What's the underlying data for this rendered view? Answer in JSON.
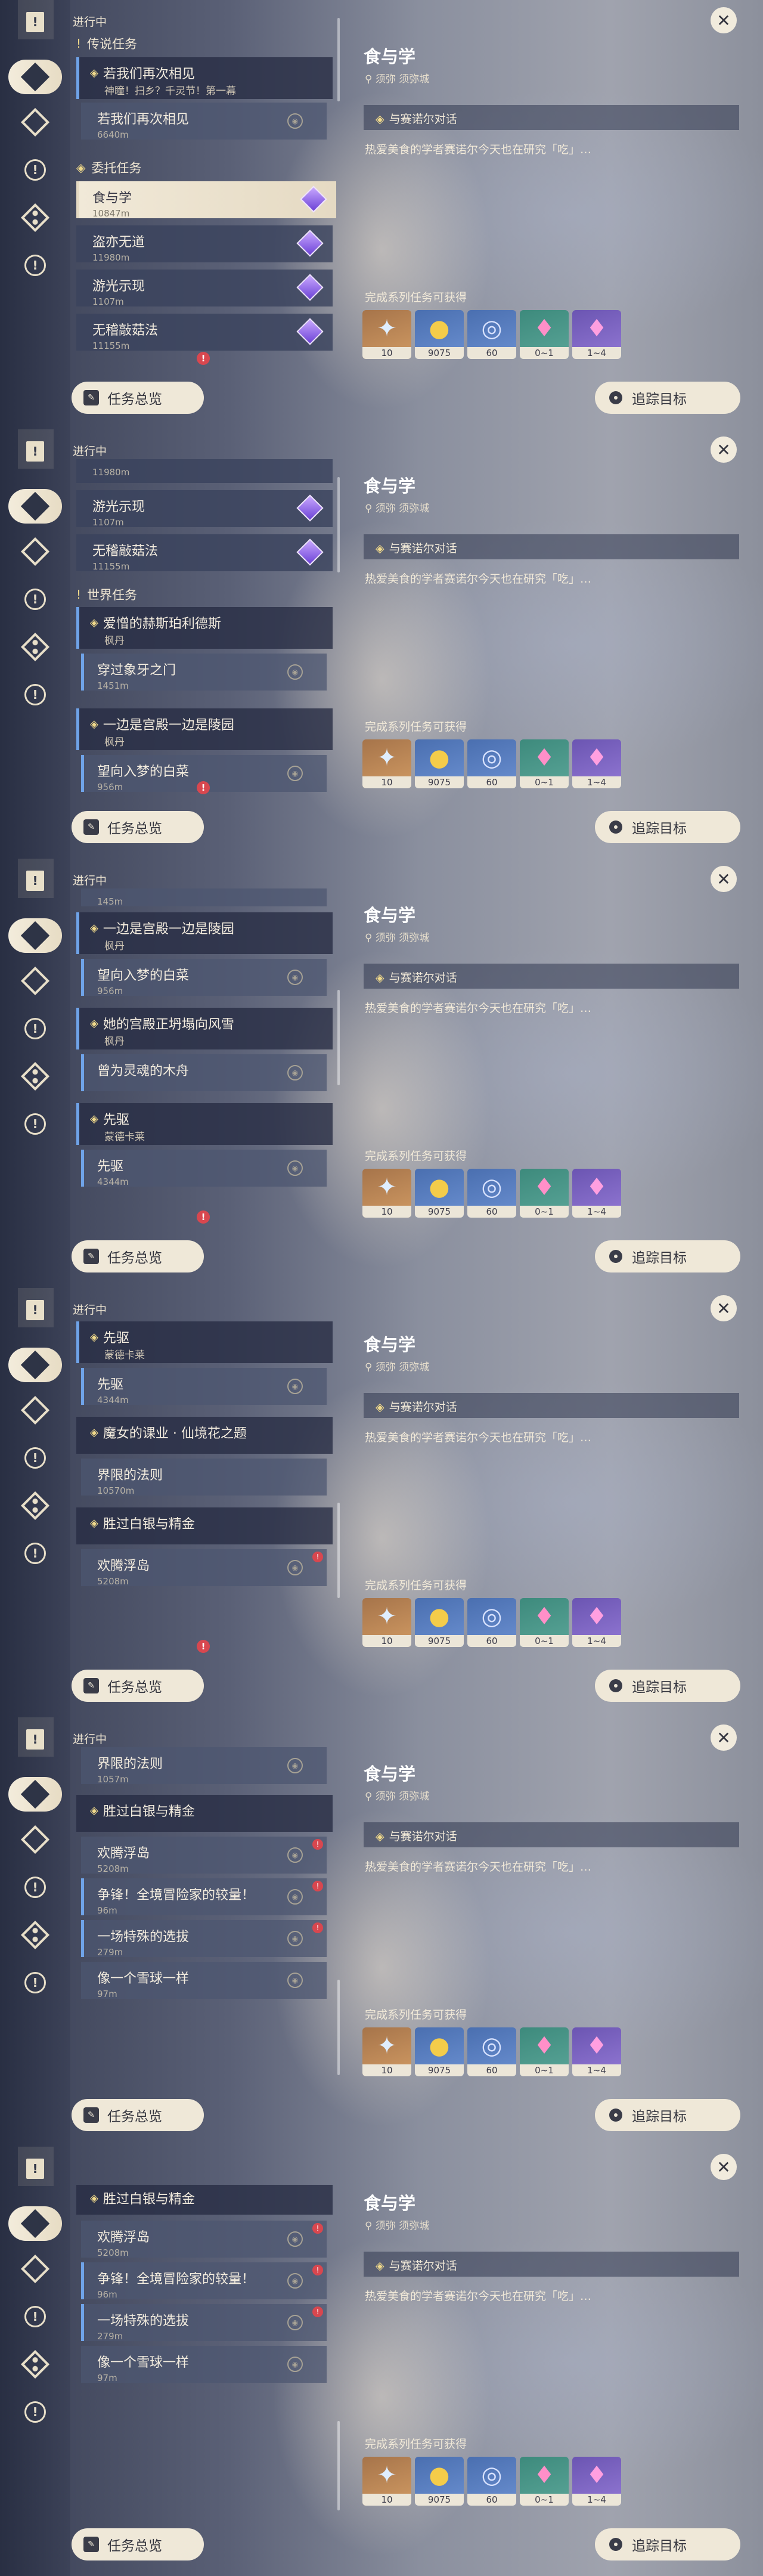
{
  "common": {
    "ongoing": "进行中",
    "overview_button": "任务总览",
    "track_button": "追踪目标",
    "quest_title": "食与学",
    "location": "须弥 须弥城",
    "objective": "与赛诺尔对话",
    "description": "热爱美食的学者赛诺尔今天也在研究「吃」…",
    "rewards_heading": "完成系列任务可获得",
    "rewards": [
      {
        "icon": "adventure-exp-icon",
        "count": "10",
        "color": "#c08d5a"
      },
      {
        "icon": "mora-icon",
        "count": "9075",
        "color": "#5a7fc2"
      },
      {
        "icon": "hero-wit-icon",
        "count": "60",
        "color": "#5a7fc2"
      },
      {
        "icon": "crystal-icon",
        "count": "0~1",
        "color": "#4a9384"
      },
      {
        "icon": "ore-icon",
        "count": "1~4",
        "color": "#7e66c8"
      }
    ]
  },
  "labels": {
    "legend": "传说任务",
    "legend_quest": "若我们再次相见",
    "legend_sub": "神瞳！扫乡？千灵节！第一幕",
    "legend_step": "若我们再次相见",
    "legend_step_dist": "6640m",
    "commission": "委托任务",
    "world": "世界任务",
    "q_shi": "食与学",
    "q_shi_d": "10847m",
    "q_dao": "盗亦无道",
    "q_dao_d": "11980m",
    "q_you": "游光示现",
    "q_you_d": "1107m",
    "q_wu": "无稽敲菇法",
    "q_wu_d": "11155m",
    "g_ai": "爱憎的赫斯珀利德斯",
    "g_ai_s": "枫丹",
    "q_chuan": "穿过象牙之门",
    "q_chuan_d": "1451m",
    "g_yibian": "一边是宫殿一边是陵园",
    "g_yibian_s": "枫丹",
    "q_wang": "望向入梦的白菜",
    "q_wang_d": "956m",
    "g_ta": "她的宫殿正坍塌向风雪",
    "g_ta_s": "枫丹",
    "q_zeng": "曾为灵魂的木舟",
    "g_xian": "先驱",
    "g_xian_s": "蒙德卡莱",
    "q_xian": "先驱",
    "q_xian_d": "4344m",
    "g_mo": "魔女的课业 · 仙境花之题",
    "q_jie": "界限的法则",
    "q_jie_d": "10570m",
    "g_sheng": "胜过白银与精金",
    "q_huan": "欢腾浮岛",
    "q_huan_d": "5208m",
    "q_zheng": "争锋！全境冒险家的较量！",
    "q_zheng_d": "96m",
    "q_yichang": "一场特殊的选拔",
    "q_yichang_d": "279m",
    "q_xiang": "像一个雪球一样",
    "q_xiang_d": "97m",
    "partial_d1": "11980m",
    "partial_d2": "145m",
    "partial_d3": "1057m"
  }
}
